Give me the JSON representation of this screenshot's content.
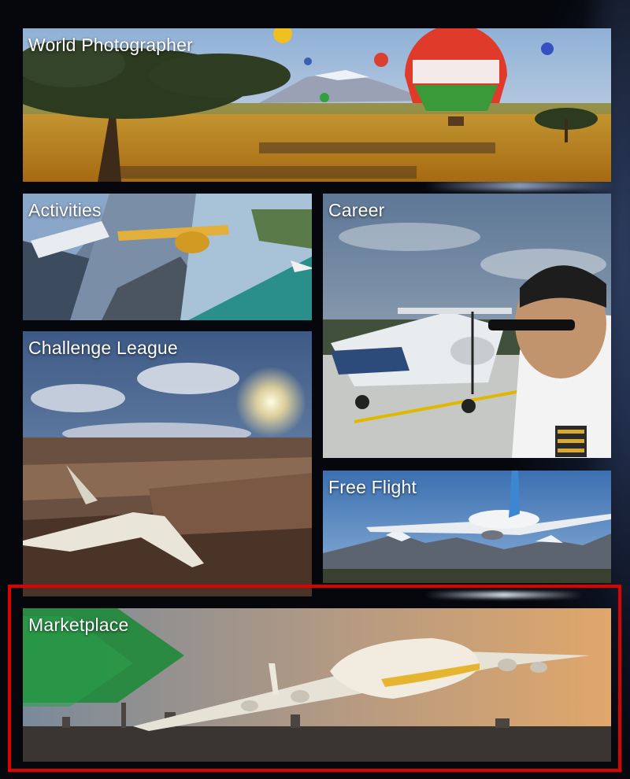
{
  "tiles": {
    "world_photographer": {
      "label": "World Photographer"
    },
    "activities": {
      "label": "Activities"
    },
    "career": {
      "label": "Career"
    },
    "challenge_league": {
      "label": "Challenge League"
    },
    "free_flight": {
      "label": "Free Flight"
    },
    "marketplace": {
      "label": "Marketplace",
      "selected": true
    }
  },
  "colors": {
    "selection_outline": "#e00000",
    "marketplace_accent": "#1f8a3a",
    "background": "#05070d"
  }
}
